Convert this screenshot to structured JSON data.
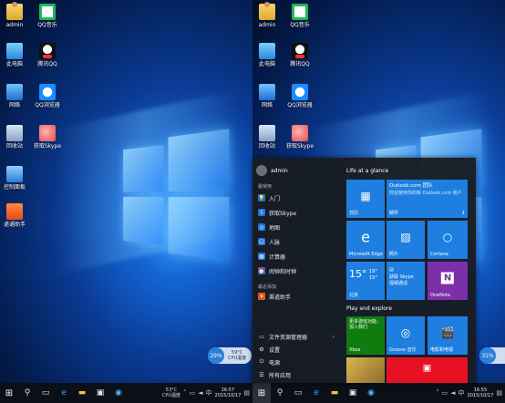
{
  "desktop_icons": [
    {
      "label": "admin",
      "icon": "folder-user-icon",
      "cls": "folder"
    },
    {
      "label": "QQ音乐",
      "icon": "qq-music-icon",
      "cls": "qqmusic"
    },
    {
      "label": "此电脑",
      "icon": "this-pc-icon",
      "cls": "pc"
    },
    {
      "label": "腾讯QQ",
      "icon": "qq-icon",
      "cls": "qq"
    },
    {
      "label": "网络",
      "icon": "network-icon",
      "cls": "net"
    },
    {
      "label": "QQ浏览器",
      "icon": "qq-browser-icon",
      "cls": "qqbrowser"
    },
    {
      "label": "回收站",
      "icon": "recycle-bin-icon",
      "cls": "bin"
    },
    {
      "label": "获取Skype",
      "icon": "skype-icon",
      "cls": "skype"
    },
    {
      "label": "控制面板",
      "icon": "control-panel-icon",
      "cls": "control"
    },
    {
      "label": "递通助手",
      "icon": "assistant-icon",
      "cls": "tool"
    }
  ],
  "taskbar": {
    "temp_value": "53°C",
    "temp_label": "CPU温度",
    "left_time": "16:57",
    "left_date": "2015/10/17",
    "right_time": "16:55",
    "right_date": "2015/10/17"
  },
  "cpu_widget_left": {
    "percent": "29%",
    "temp": "59°C",
    "label": "CPU温度"
  },
  "cpu_widget_right": {
    "percent": "31%",
    "temp": "59°C",
    "label": "CPU温度"
  },
  "start_menu": {
    "user": "admin",
    "most_used_heading": "最常用",
    "most_used": [
      {
        "label": "入门",
        "icon": "lightbulb-icon",
        "color": "#1e6fd9",
        "glyph": "💡"
      },
      {
        "label": "获取Skype",
        "icon": "skype-icon",
        "color": "#1e6fd9",
        "glyph": "S"
      },
      {
        "label": "地图",
        "icon": "maps-icon",
        "color": "#1e6fd9",
        "glyph": "◎"
      },
      {
        "label": "人脉",
        "icon": "people-icon",
        "color": "#1e6fd9",
        "glyph": "☺"
      },
      {
        "label": "计算器",
        "icon": "calculator-icon",
        "color": "#1e6fd9",
        "glyph": "▦"
      },
      {
        "label": "闹钟和时钟",
        "icon": "alarm-icon",
        "color": "#1e6fd9",
        "glyph": "⏰"
      }
    ],
    "recent_heading": "最近添加",
    "recent": [
      {
        "label": "渠道助手",
        "icon": "channel-helper-icon",
        "color": "#e2561b",
        "glyph": "✦"
      }
    ],
    "bottom": [
      {
        "label": "文件资源管理器",
        "icon": "file-explorer-icon",
        "glyph": "▭"
      },
      {
        "label": "设置",
        "icon": "settings-icon",
        "glyph": "⚙"
      },
      {
        "label": "电源",
        "icon": "power-icon",
        "glyph": "⏻"
      },
      {
        "label": "所有应用",
        "icon": "all-apps-icon",
        "glyph": "☰"
      }
    ],
    "group1": "Life at a glance",
    "group2": "Play and explore",
    "tiles": {
      "calendar": "日历",
      "mail_title": "Outlook.com 团队",
      "mail_sub": "欢迎使用你的新 Outlook.com 帐户",
      "mail_label": "邮件",
      "mail_count": "1",
      "edge": "Microsoft Edge",
      "photos": "照片",
      "cortana": "Cortana",
      "weather_temp": "15°",
      "weather_hi": "19°",
      "weather_lo": "15°",
      "weather_city": "北京",
      "skype_title": "获取 Skype",
      "skype_sub": "视频通话",
      "onenote": "OneNote",
      "xbox_title": "更多游戏功能，加入我们",
      "xbox": "Xbox",
      "groove": "Groove 音乐",
      "movies": "电影和电视"
    }
  }
}
